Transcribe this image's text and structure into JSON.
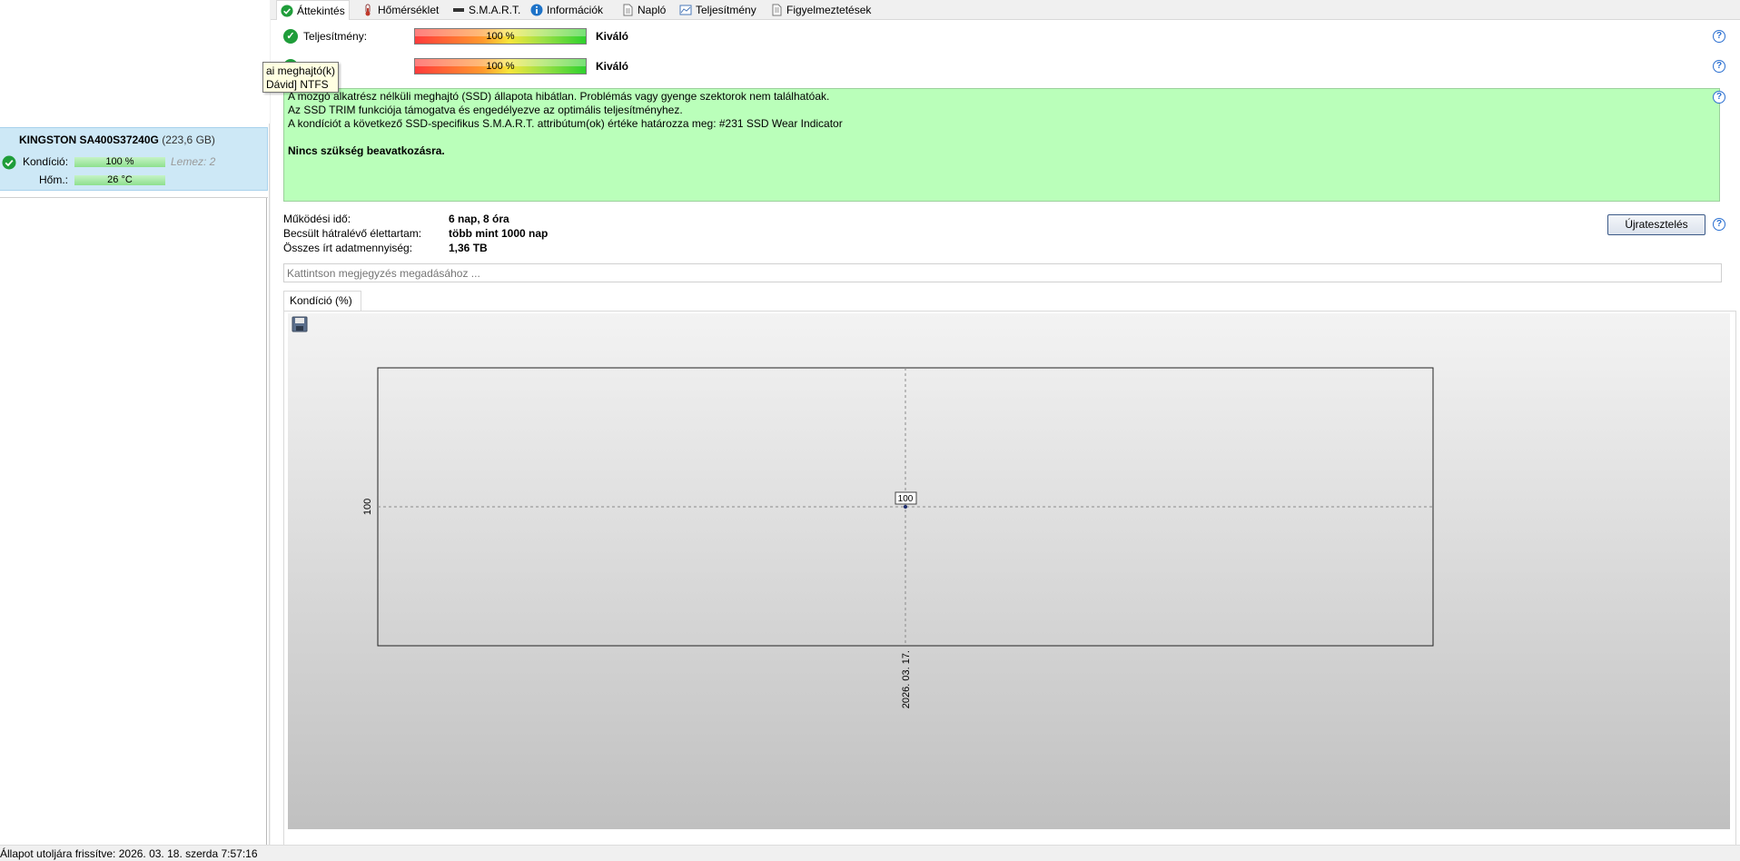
{
  "tabs": [
    {
      "label": "Áttekintés",
      "icon": "check-circle-icon"
    },
    {
      "label": "Hőmérséklet",
      "icon": "thermometer-icon"
    },
    {
      "label": "S.M.A.R.T.",
      "icon": "drive-icon"
    },
    {
      "label": "Információk",
      "icon": "info-icon"
    },
    {
      "label": "Napló",
      "icon": "document-icon"
    },
    {
      "label": "Teljesítmény",
      "icon": "chart-icon"
    },
    {
      "label": "Figyelmeztetések",
      "icon": "warning-doc-icon"
    }
  ],
  "tooltip": {
    "line1": "ai meghajtó(k)",
    "line2": "Dávid] NTFS"
  },
  "drive": {
    "name": "KINGSTON SA400S37240G",
    "size": "(223,6 GB)",
    "health_label": "Kondíció:",
    "health_value": "100 %",
    "health_fraction": 1.0,
    "disk_label": "Lemez: 2",
    "temp_label": "Hőm.:",
    "temp_value": "26 °C"
  },
  "overview": {
    "performance_label": "Teljesítmény:",
    "performance_percent": "100 %",
    "performance_rating": "Kiváló",
    "health_label": "ó:",
    "health_percent": "100 %",
    "health_rating": "Kiváló",
    "description": [
      "A mozgó alkatrész nélküli meghajtó (SSD) állapota hibátlan. Problémás vagy gyenge szektorok nem találhatóak.",
      "Az SSD TRIM funkciója támogatva és engedélyezve az optimális teljesítményhez.",
      "A kondíciót a következő SSD-specifikus S.M.A.R.T. attribútum(ok) értéke határozza meg:  #231 SSD Wear Indicator"
    ],
    "recommendation": "Nincs szükség beavatkozásra.",
    "uptime_label": "Működési idő:",
    "uptime_value": "6 nap, 8 óra",
    "lifetime_label": "Becsült hátralévő élettartam:",
    "lifetime_value": "több mint 1000 nap",
    "written_label": "Összes írt adatmennyiség:",
    "written_value": "1,36 TB",
    "retest_label": "Újratesztelés",
    "note_placeholder": "Kattintson megjegyzés megadásához ..."
  },
  "chart_tab": "Kondíció  (%)",
  "chart_data": {
    "type": "line",
    "x": [
      "2026. 03. 17."
    ],
    "series": [
      {
        "values": [
          100
        ]
      }
    ],
    "data_labels": [
      "100"
    ],
    "y_tick_labels": [
      "100"
    ],
    "x_tick_labels": [
      "2026. 03. 17."
    ],
    "grid": "dashed crosshair"
  },
  "statusbar": "Állapot utoljára frissítve: 2026. 03. 18. szerda 7:57:16"
}
